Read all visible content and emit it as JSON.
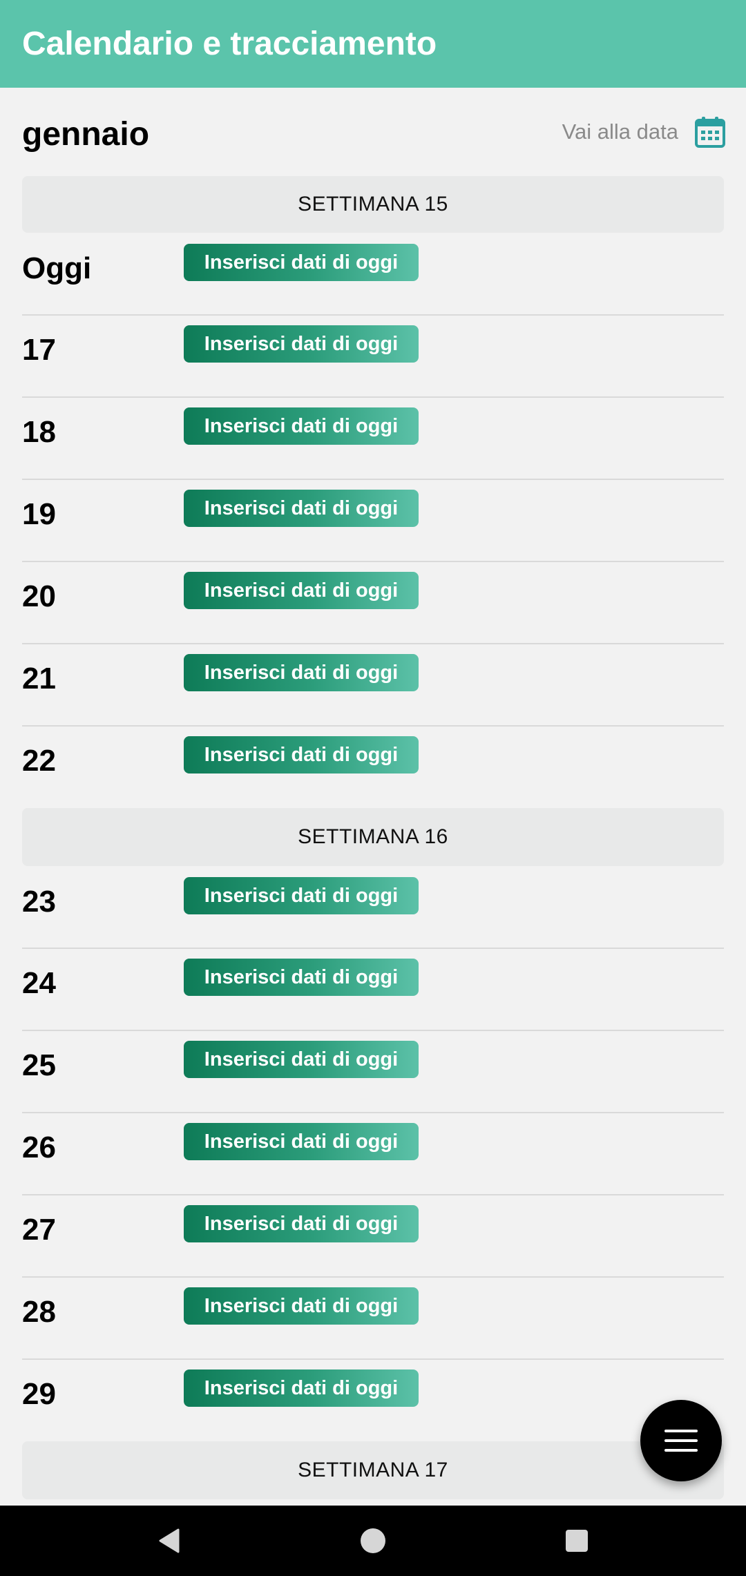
{
  "header": {
    "title": "Calendario e tracciamento",
    "color": "#5bc4ab"
  },
  "month": {
    "title": "gennaio",
    "goto_label": "Vai alla data",
    "goto_icon": "calendar-icon"
  },
  "weeks": [
    {
      "label": "SETTIMANA 15",
      "days": [
        {
          "label": "Oggi",
          "button": "Inserisci dati di oggi"
        },
        {
          "label": "17",
          "button": "Inserisci dati di oggi"
        },
        {
          "label": "18",
          "button": "Inserisci dati di oggi"
        },
        {
          "label": "19",
          "button": "Inserisci dati di oggi"
        },
        {
          "label": "20",
          "button": "Inserisci dati di oggi"
        },
        {
          "label": "21",
          "button": "Inserisci dati di oggi"
        },
        {
          "label": "22",
          "button": "Inserisci dati di oggi"
        }
      ]
    },
    {
      "label": "SETTIMANA 16",
      "days": [
        {
          "label": "23",
          "button": "Inserisci dati di oggi"
        },
        {
          "label": "24",
          "button": "Inserisci dati di oggi"
        },
        {
          "label": "25",
          "button": "Inserisci dati di oggi"
        },
        {
          "label": "26",
          "button": "Inserisci dati di oggi"
        },
        {
          "label": "27",
          "button": "Inserisci dati di oggi"
        },
        {
          "label": "28",
          "button": "Inserisci dati di oggi"
        },
        {
          "label": "29",
          "button": "Inserisci dati di oggi"
        }
      ]
    },
    {
      "label": "SETTIMANA 17",
      "days": []
    }
  ],
  "fab": {
    "icon": "menu-icon"
  },
  "nav_bar": {
    "back_icon": "back-triangle-icon",
    "home_icon": "home-circle-icon",
    "recents_icon": "recents-square-icon"
  },
  "colors": {
    "accent": "#5bc4ab",
    "button_start": "#0e7b57",
    "button_end": "#5cc1a8",
    "background": "#f2f2f2"
  }
}
